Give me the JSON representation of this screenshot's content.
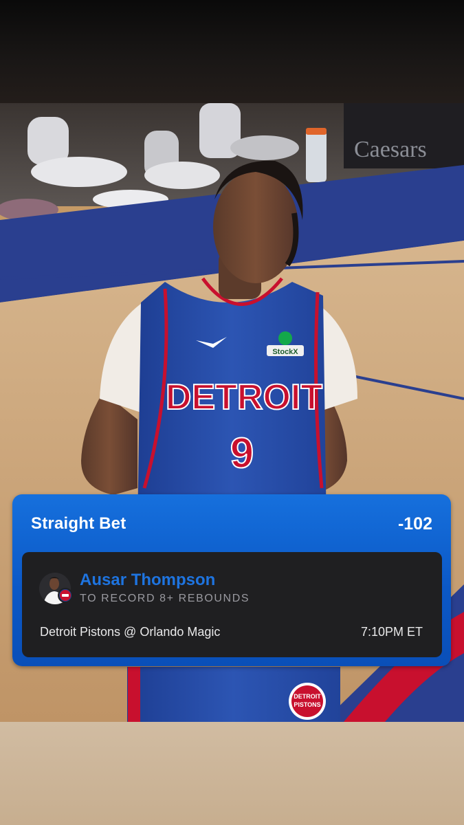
{
  "bet_card": {
    "bet_type": "Straight Bet",
    "odds": "-102",
    "player_name": "Ausar Thompson",
    "prop": "TO RECORD 8+ REBOUNDS",
    "matchup": "Detroit Pistons @ Orlando Magic",
    "game_time": "7:10PM ET"
  },
  "photo": {
    "jersey_text": "DETROIT",
    "jersey_number": "9",
    "sponsor_patch": "StockX",
    "shorts_logo_line1": "DETROIT",
    "shorts_logo_line2": "PISTONS",
    "signage_text": "Caesars"
  },
  "colors": {
    "card_blue": "#0b58c6",
    "panel_dark": "#1f1f21",
    "player_name_blue": "#1e74e0",
    "pistons_blue": "#1d428a",
    "pistons_red": "#c8102e"
  },
  "icons": {
    "avatar": "player-headshot",
    "team_badge": "pistons-logo-icon"
  }
}
